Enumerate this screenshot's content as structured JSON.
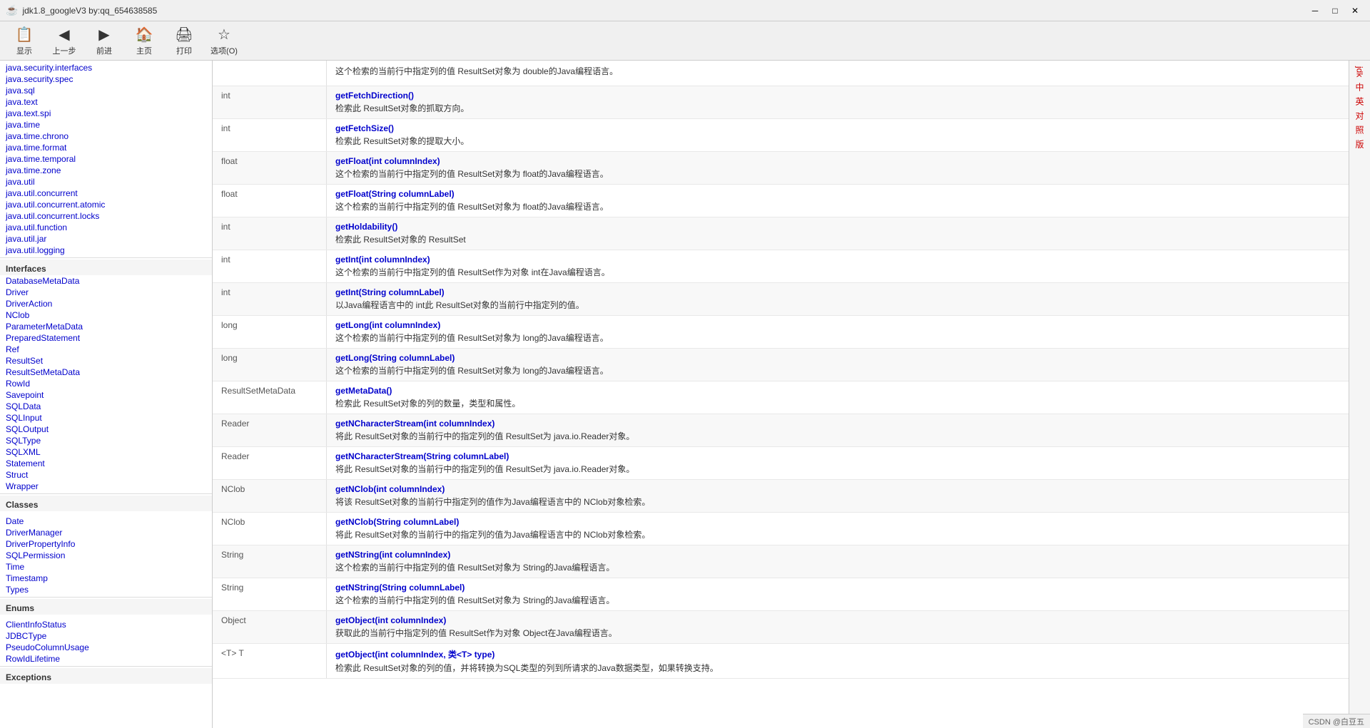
{
  "titlebar": {
    "title": "jdk1.8_googleV3 by:qq_654638585",
    "minimize_label": "─",
    "restore_label": "□",
    "close_label": "✕"
  },
  "toolbar": {
    "items": [
      {
        "id": "display",
        "icon": "📋",
        "label": "显示"
      },
      {
        "id": "back",
        "icon": "⬅",
        "label": "上一步"
      },
      {
        "id": "forward",
        "icon": "➡",
        "label": "前进"
      },
      {
        "id": "home",
        "icon": "🏠",
        "label": "主页"
      },
      {
        "id": "print",
        "icon": "🖨",
        "label": "打印"
      },
      {
        "id": "options",
        "icon": "☆",
        "label": "选项(O)"
      }
    ]
  },
  "sidebar": {
    "top_items": [
      "java.security.interfaces",
      "java.security.spec",
      "java.sql",
      "java.text",
      "java.text.spi",
      "java.time",
      "java.time.chrono",
      "java.time.format",
      "java.time.temporal",
      "java.time.zone",
      "java.util",
      "java.util.concurrent",
      "java.util.concurrent.atomic",
      "java.util.concurrent.locks",
      "java.util.function",
      "java.util.jar",
      "java.util.logging"
    ],
    "interfaces_header": "Interfaces",
    "interfaces": [
      "DatabaseMetaData",
      "Driver",
      "DriverAction",
      "NClob",
      "ParameterMetaData",
      "PreparedStatement",
      "Ref",
      "ResultSet",
      "ResultSetMetaData",
      "RowId",
      "Savepoint",
      "SQLData",
      "SQLInput",
      "SQLOutput",
      "SQLType",
      "SQLXML",
      "Statement",
      "Struct",
      "Wrapper"
    ],
    "classes_header": "Classes",
    "classes": [
      "Date",
      "DriverManager",
      "DriverPropertyInfo",
      "SQLPermission",
      "Time",
      "Timestamp",
      "Types"
    ],
    "enums_header": "Enums",
    "enums": [
      "ClientInfoStatus",
      "JDBCType",
      "PseudoColumnUsage",
      "RowIdLifetime"
    ],
    "exceptions_header": "Exceptions"
  },
  "content": {
    "top_desc": "这个检索的当前行中指定列的值 ResultSet对象为 double的Java编程语言。",
    "rows": [
      {
        "type": "int",
        "method": "getFetchDirection()",
        "desc": "检索此 ResultSet对象的抓取方向。"
      },
      {
        "type": "int",
        "method": "getFetchSize()",
        "desc": "检索此 ResultSet对象的提取大小。"
      },
      {
        "type": "float",
        "method": "getFloat(int columnIndex)",
        "desc": "这个检索的当前行中指定列的值 ResultSet对象为 float的Java编程语言。"
      },
      {
        "type": "float",
        "method": "getFloat(String columnLabel)",
        "desc": "这个检索的当前行中指定列的值 ResultSet对象为 float的Java编程语言。"
      },
      {
        "type": "int",
        "method": "getHoldability()",
        "desc": "检索此 ResultSet对象的 ResultSet"
      },
      {
        "type": "int",
        "method": "getInt(int columnIndex)",
        "desc": "这个检索的当前行中指定列的值 ResultSet作为对象 int在Java编程语言。"
      },
      {
        "type": "int",
        "method": "getInt(String columnLabel)",
        "desc": "以Java编程语言中的 int此 ResultSet对象的当前行中指定列的值。"
      },
      {
        "type": "long",
        "method": "getLong(int columnIndex)",
        "desc": "这个检索的当前行中指定列的值 ResultSet对象为 long的Java编程语言。"
      },
      {
        "type": "long",
        "method": "getLong(String columnLabel)",
        "desc": "这个检索的当前行中指定列的值 ResultSet对象为 long的Java编程语言。"
      },
      {
        "type": "ResultSetMetaData",
        "method": "getMetaData()",
        "desc": "检索此 ResultSet对象的列的数量，类型和属性。"
      },
      {
        "type": "Reader",
        "method": "getNCharacterStream(int columnIndex)",
        "desc": "将此 ResultSet对象的当前行中的指定列的值 ResultSet为 java.io.Reader对象。"
      },
      {
        "type": "Reader",
        "method": "getNCharacterStream(String columnLabel)",
        "desc": "将此 ResultSet对象的当前行中的指定列的值 ResultSet为 java.io.Reader对象。"
      },
      {
        "type": "NClob",
        "method": "getNClob(int columnIndex)",
        "desc": "将该 ResultSet对象的当前行中指定列的值作为Java编程语言中的 NClob对象检索。"
      },
      {
        "type": "NClob",
        "method": "getNClob(String columnLabel)",
        "desc": "将此 ResultSet对象的当前行中的指定列的值为Java编程语言中的 NClob对象检索。"
      },
      {
        "type": "String",
        "method": "getNString(int columnIndex)",
        "desc": "这个检索的当前行中指定列的值 ResultSet对象为 String的Java编程语言。"
      },
      {
        "type": "String",
        "method": "getNString(String columnLabel)",
        "desc": "这个检索的当前行中指定列的值 ResultSet对象为 String的Java编程语言。"
      },
      {
        "type": "Object",
        "method": "getObject(int columnIndex)",
        "desc": "获取此的当前行中指定列的值 ResultSet作为对象 Object在Java编程语言。"
      },
      {
        "type": "<T> T",
        "method": "getObject(int columnIndex, 类<T> type)",
        "desc": "检索此 ResultSet对象的列的值，并将转换为SQL类型的列到所请求的Java数据类型，如果转换支持。"
      }
    ]
  },
  "right_panel": {
    "items": [
      "jdk",
      "中",
      "英",
      "对",
      "照",
      "版"
    ]
  },
  "statusbar": {
    "text": "CSDN @白豆五"
  }
}
